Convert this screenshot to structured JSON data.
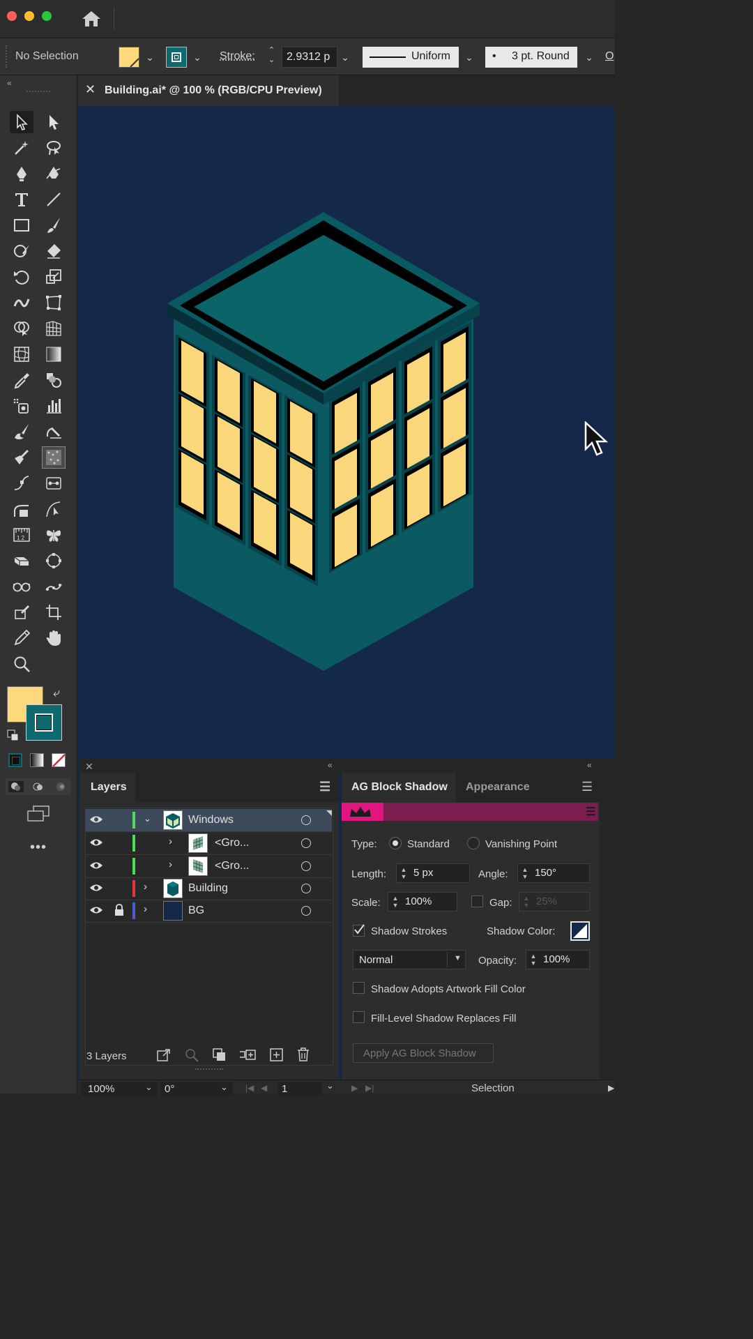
{
  "app": {
    "control_bar": {
      "selection_label": "No Selection",
      "stroke_label": "Stroke:",
      "stroke_value": "2.9312 p",
      "profile_label": "Uniform",
      "brush_label": "3 pt. Round",
      "overflow_label": "O"
    },
    "document_tab": {
      "title": "Building.ai* @ 100 % (RGB/CPU Preview)"
    },
    "colors": {
      "fill": "#fdd97c",
      "stroke": "#0f6a6f",
      "canvas": "#14294a",
      "building": "#0b5a62",
      "roof": "#0a6468",
      "window": "#fbd77b"
    }
  },
  "layers_panel": {
    "title": "Layers",
    "layers": [
      {
        "name": "Windows",
        "expanded": true,
        "color": "#4ddb57"
      },
      {
        "name": "<Gro...",
        "indent": true,
        "color": "#4ddb57"
      },
      {
        "name": "<Gro...",
        "indent": true,
        "color": "#4ddb57"
      },
      {
        "name": "Building",
        "color": "#e0363a"
      },
      {
        "name": "BG",
        "locked": true,
        "color": "#4a5bd8"
      }
    ],
    "footer_count": "3 Layers"
  },
  "block_shadow_panel": {
    "tab_active": "AG Block Shadow",
    "tab_inactive": "Appearance",
    "type_label": "Type:",
    "type_standard": "Standard",
    "type_vanishing": "Vanishing Point",
    "length_label": "Length:",
    "length_value": "5 px",
    "angle_label": "Angle:",
    "angle_value": "150°",
    "scale_label": "Scale:",
    "scale_value": "100%",
    "gap_label": "Gap:",
    "gap_value": "25%",
    "shadow_strokes_label": "Shadow Strokes",
    "shadow_color_label": "Shadow Color:",
    "blend_mode": "Normal",
    "opacity_label": "Opacity:",
    "opacity_value": "100%",
    "adopts_fill_label": "Shadow Adopts Artwork Fill Color",
    "replaces_fill_label": "Fill-Level Shadow Replaces Fill",
    "apply_button": "Apply AG Block Shadow"
  },
  "status_bar": {
    "zoom": "100%",
    "rotation": "0°",
    "artboard": "1",
    "tool": "Selection"
  }
}
